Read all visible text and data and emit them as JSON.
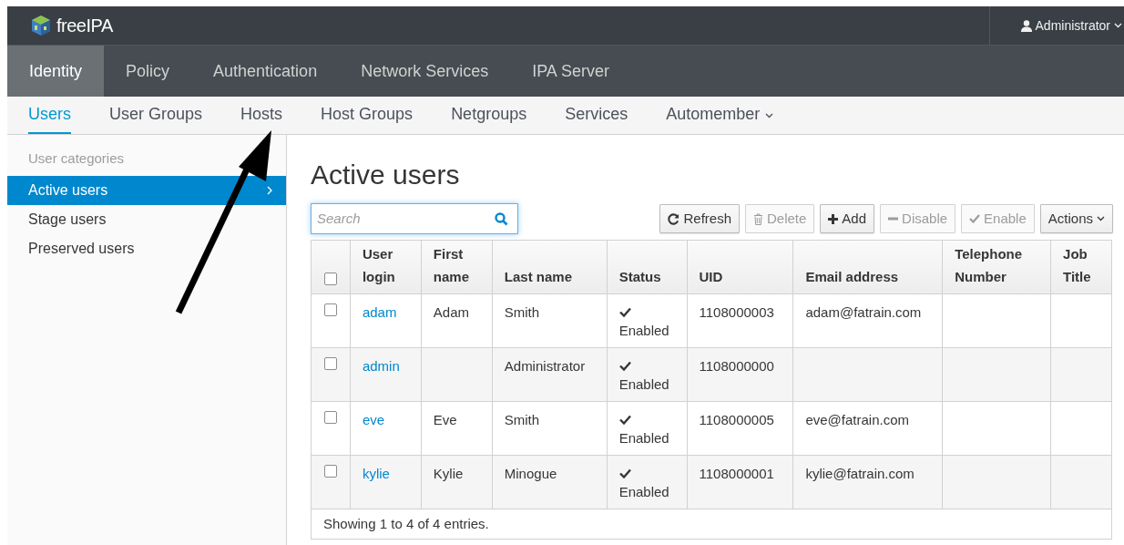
{
  "header": {
    "brand": "freeIPA",
    "user_menu": "Administrator"
  },
  "main_nav": [
    {
      "label": "Identity",
      "selected": true
    },
    {
      "label": "Policy",
      "selected": false
    },
    {
      "label": "Authentication",
      "selected": false
    },
    {
      "label": "Network Services",
      "selected": false
    },
    {
      "label": "IPA Server",
      "selected": false
    }
  ],
  "sub_nav": [
    {
      "label": "Users",
      "selected": true,
      "dropdown": false
    },
    {
      "label": "User Groups",
      "selected": false,
      "dropdown": false
    },
    {
      "label": "Hosts",
      "selected": false,
      "dropdown": false
    },
    {
      "label": "Host Groups",
      "selected": false,
      "dropdown": false
    },
    {
      "label": "Netgroups",
      "selected": false,
      "dropdown": false
    },
    {
      "label": "Services",
      "selected": false,
      "dropdown": false
    },
    {
      "label": "Automember",
      "selected": false,
      "dropdown": true
    }
  ],
  "sidebar": {
    "heading": "User categories",
    "items": [
      {
        "label": "Active users",
        "selected": true
      },
      {
        "label": "Stage users",
        "selected": false
      },
      {
        "label": "Preserved users",
        "selected": false
      }
    ]
  },
  "page_title": "Active users",
  "search": {
    "placeholder": "Search"
  },
  "toolbar": [
    {
      "kind": "refresh",
      "label": "Refresh",
      "disabled": false
    },
    {
      "kind": "delete",
      "label": "Delete",
      "disabled": true
    },
    {
      "kind": "add",
      "label": "Add",
      "disabled": false
    },
    {
      "kind": "disable",
      "label": "Disable",
      "disabled": true
    },
    {
      "kind": "enable",
      "label": "Enable",
      "disabled": true
    },
    {
      "kind": "actions",
      "label": "Actions",
      "disabled": false
    }
  ],
  "table": {
    "select_all_checked": false,
    "columns": [
      "User login",
      "First name",
      "Last name",
      "Status",
      "UID",
      "Email address",
      "Telephone Number",
      "Job Title"
    ],
    "rows": [
      {
        "checked": false,
        "login": "adam",
        "first": "Adam",
        "last": "Smith",
        "status": "Enabled",
        "uid": "1108000003",
        "email": "adam@fatrain.com"
      },
      {
        "checked": false,
        "login": "admin",
        "first": "",
        "last": "Administrator",
        "status": "Enabled",
        "uid": "1108000000",
        "email": ""
      },
      {
        "checked": false,
        "login": "eve",
        "first": "Eve",
        "last": "Smith",
        "status": "Enabled",
        "uid": "1108000005",
        "email": "eve@fatrain.com"
      },
      {
        "checked": false,
        "login": "kylie",
        "first": "Kylie",
        "last": "Minogue",
        "status": "Enabled",
        "uid": "1108000001",
        "email": "kylie@fatrain.com"
      }
    ],
    "footer": "Showing 1 to 4 of 4 entries."
  }
}
